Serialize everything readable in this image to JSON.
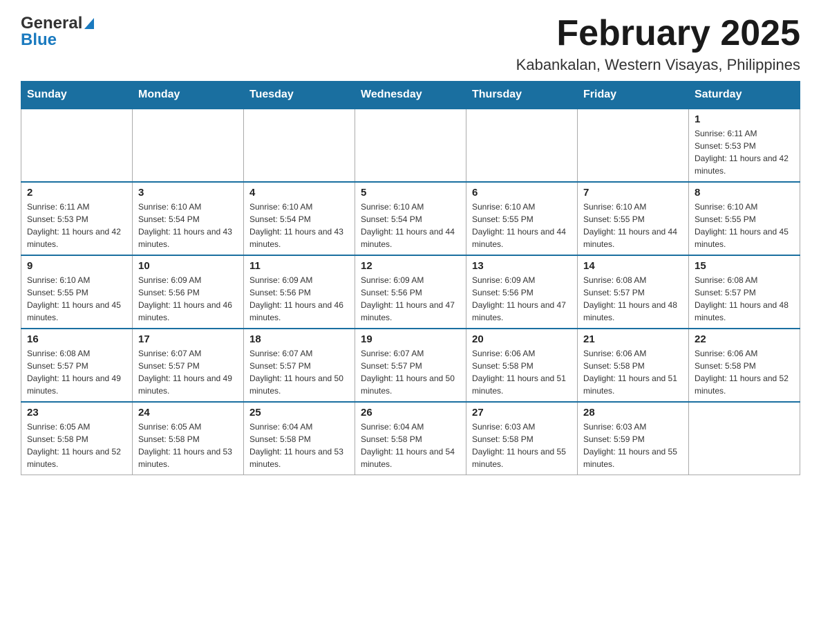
{
  "header": {
    "logo_general": "General",
    "logo_blue": "Blue",
    "month_title": "February 2025",
    "location": "Kabankalan, Western Visayas, Philippines"
  },
  "days_of_week": [
    "Sunday",
    "Monday",
    "Tuesday",
    "Wednesday",
    "Thursday",
    "Friday",
    "Saturday"
  ],
  "weeks": [
    {
      "days": [
        {
          "number": "",
          "sunrise": "",
          "sunset": "",
          "daylight": ""
        },
        {
          "number": "",
          "sunrise": "",
          "sunset": "",
          "daylight": ""
        },
        {
          "number": "",
          "sunrise": "",
          "sunset": "",
          "daylight": ""
        },
        {
          "number": "",
          "sunrise": "",
          "sunset": "",
          "daylight": ""
        },
        {
          "number": "",
          "sunrise": "",
          "sunset": "",
          "daylight": ""
        },
        {
          "number": "",
          "sunrise": "",
          "sunset": "",
          "daylight": ""
        },
        {
          "number": "1",
          "sunrise": "Sunrise: 6:11 AM",
          "sunset": "Sunset: 5:53 PM",
          "daylight": "Daylight: 11 hours and 42 minutes."
        }
      ]
    },
    {
      "days": [
        {
          "number": "2",
          "sunrise": "Sunrise: 6:11 AM",
          "sunset": "Sunset: 5:53 PM",
          "daylight": "Daylight: 11 hours and 42 minutes."
        },
        {
          "number": "3",
          "sunrise": "Sunrise: 6:10 AM",
          "sunset": "Sunset: 5:54 PM",
          "daylight": "Daylight: 11 hours and 43 minutes."
        },
        {
          "number": "4",
          "sunrise": "Sunrise: 6:10 AM",
          "sunset": "Sunset: 5:54 PM",
          "daylight": "Daylight: 11 hours and 43 minutes."
        },
        {
          "number": "5",
          "sunrise": "Sunrise: 6:10 AM",
          "sunset": "Sunset: 5:54 PM",
          "daylight": "Daylight: 11 hours and 44 minutes."
        },
        {
          "number": "6",
          "sunrise": "Sunrise: 6:10 AM",
          "sunset": "Sunset: 5:55 PM",
          "daylight": "Daylight: 11 hours and 44 minutes."
        },
        {
          "number": "7",
          "sunrise": "Sunrise: 6:10 AM",
          "sunset": "Sunset: 5:55 PM",
          "daylight": "Daylight: 11 hours and 44 minutes."
        },
        {
          "number": "8",
          "sunrise": "Sunrise: 6:10 AM",
          "sunset": "Sunset: 5:55 PM",
          "daylight": "Daylight: 11 hours and 45 minutes."
        }
      ]
    },
    {
      "days": [
        {
          "number": "9",
          "sunrise": "Sunrise: 6:10 AM",
          "sunset": "Sunset: 5:55 PM",
          "daylight": "Daylight: 11 hours and 45 minutes."
        },
        {
          "number": "10",
          "sunrise": "Sunrise: 6:09 AM",
          "sunset": "Sunset: 5:56 PM",
          "daylight": "Daylight: 11 hours and 46 minutes."
        },
        {
          "number": "11",
          "sunrise": "Sunrise: 6:09 AM",
          "sunset": "Sunset: 5:56 PM",
          "daylight": "Daylight: 11 hours and 46 minutes."
        },
        {
          "number": "12",
          "sunrise": "Sunrise: 6:09 AM",
          "sunset": "Sunset: 5:56 PM",
          "daylight": "Daylight: 11 hours and 47 minutes."
        },
        {
          "number": "13",
          "sunrise": "Sunrise: 6:09 AM",
          "sunset": "Sunset: 5:56 PM",
          "daylight": "Daylight: 11 hours and 47 minutes."
        },
        {
          "number": "14",
          "sunrise": "Sunrise: 6:08 AM",
          "sunset": "Sunset: 5:57 PM",
          "daylight": "Daylight: 11 hours and 48 minutes."
        },
        {
          "number": "15",
          "sunrise": "Sunrise: 6:08 AM",
          "sunset": "Sunset: 5:57 PM",
          "daylight": "Daylight: 11 hours and 48 minutes."
        }
      ]
    },
    {
      "days": [
        {
          "number": "16",
          "sunrise": "Sunrise: 6:08 AM",
          "sunset": "Sunset: 5:57 PM",
          "daylight": "Daylight: 11 hours and 49 minutes."
        },
        {
          "number": "17",
          "sunrise": "Sunrise: 6:07 AM",
          "sunset": "Sunset: 5:57 PM",
          "daylight": "Daylight: 11 hours and 49 minutes."
        },
        {
          "number": "18",
          "sunrise": "Sunrise: 6:07 AM",
          "sunset": "Sunset: 5:57 PM",
          "daylight": "Daylight: 11 hours and 50 minutes."
        },
        {
          "number": "19",
          "sunrise": "Sunrise: 6:07 AM",
          "sunset": "Sunset: 5:57 PM",
          "daylight": "Daylight: 11 hours and 50 minutes."
        },
        {
          "number": "20",
          "sunrise": "Sunrise: 6:06 AM",
          "sunset": "Sunset: 5:58 PM",
          "daylight": "Daylight: 11 hours and 51 minutes."
        },
        {
          "number": "21",
          "sunrise": "Sunrise: 6:06 AM",
          "sunset": "Sunset: 5:58 PM",
          "daylight": "Daylight: 11 hours and 51 minutes."
        },
        {
          "number": "22",
          "sunrise": "Sunrise: 6:06 AM",
          "sunset": "Sunset: 5:58 PM",
          "daylight": "Daylight: 11 hours and 52 minutes."
        }
      ]
    },
    {
      "days": [
        {
          "number": "23",
          "sunrise": "Sunrise: 6:05 AM",
          "sunset": "Sunset: 5:58 PM",
          "daylight": "Daylight: 11 hours and 52 minutes."
        },
        {
          "number": "24",
          "sunrise": "Sunrise: 6:05 AM",
          "sunset": "Sunset: 5:58 PM",
          "daylight": "Daylight: 11 hours and 53 minutes."
        },
        {
          "number": "25",
          "sunrise": "Sunrise: 6:04 AM",
          "sunset": "Sunset: 5:58 PM",
          "daylight": "Daylight: 11 hours and 53 minutes."
        },
        {
          "number": "26",
          "sunrise": "Sunrise: 6:04 AM",
          "sunset": "Sunset: 5:58 PM",
          "daylight": "Daylight: 11 hours and 54 minutes."
        },
        {
          "number": "27",
          "sunrise": "Sunrise: 6:03 AM",
          "sunset": "Sunset: 5:58 PM",
          "daylight": "Daylight: 11 hours and 55 minutes."
        },
        {
          "number": "28",
          "sunrise": "Sunrise: 6:03 AM",
          "sunset": "Sunset: 5:59 PM",
          "daylight": "Daylight: 11 hours and 55 minutes."
        },
        {
          "number": "",
          "sunrise": "",
          "sunset": "",
          "daylight": ""
        }
      ]
    }
  ]
}
